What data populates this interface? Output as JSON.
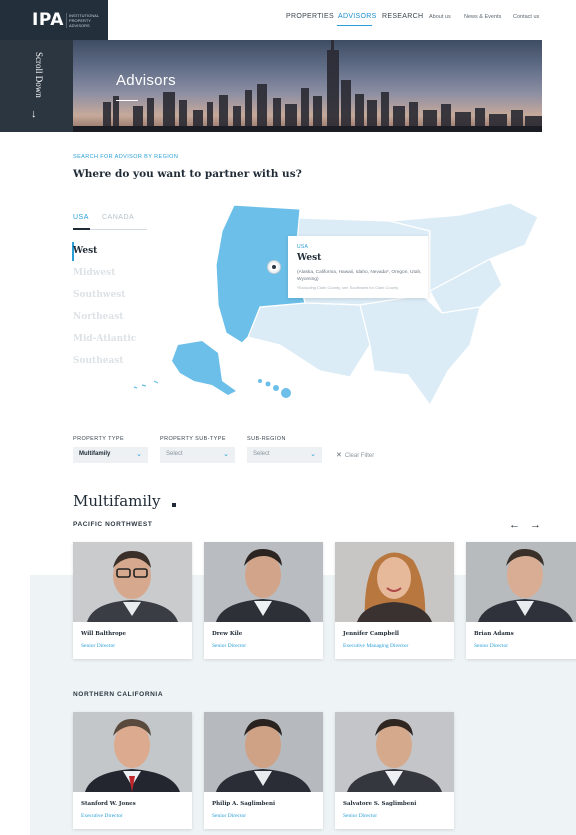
{
  "brand": {
    "logo_text": "IPA",
    "logo_subtext": "INSTITUTIONAL PROPERTY ADVISORS"
  },
  "nav": {
    "items": [
      {
        "label": "PROPERTIES"
      },
      {
        "label": "ADVISORS",
        "active": true
      },
      {
        "label": "RESEARCH"
      },
      {
        "label": "About us"
      },
      {
        "label": "News & Events"
      },
      {
        "label": "Contact us"
      }
    ]
  },
  "side": {
    "scroll_label": "Scroll Down",
    "arrow_icon": "arrow-down-icon"
  },
  "hero": {
    "title": "Advisors"
  },
  "search": {
    "eyebrow": "SEARCH FOR ADVISOR BY REGION",
    "headline": "Where do you want to partner with us?"
  },
  "country_tabs": [
    {
      "label": "USA",
      "active": true
    },
    {
      "label": "CANADA"
    }
  ],
  "regions": [
    {
      "label": "West",
      "active": true
    },
    {
      "label": "Midwest"
    },
    {
      "label": "Southwest"
    },
    {
      "label": "Northeast"
    },
    {
      "label": "Mid-Atlantic"
    },
    {
      "label": "Southeast"
    }
  ],
  "map_tooltip": {
    "country": "USA",
    "region": "West",
    "states": "(Alaska, California, Hawaii, Idaho, Nevada*, Oregon, Utah, Wyoming)",
    "note": "*Excluding Clark County, see Southwest for Clark County"
  },
  "colors": {
    "accent": "#2a9fd6",
    "map_active": "#6bbfe8",
    "map_inactive": "#dcecf6",
    "dark": "#232f3b"
  },
  "filters": {
    "property_type": {
      "label": "PROPERTY TYPE",
      "value": "Multifamily"
    },
    "property_sub_type": {
      "label": "PROPERTY SUB-TYPE",
      "value": "Select"
    },
    "sub_region": {
      "label": "SUB-REGION",
      "value": "Select"
    },
    "clear_label": "Clear Filter"
  },
  "results": {
    "title": "Multifamily",
    "prev_icon": "arrow-left-icon",
    "next_icon": "arrow-right-icon",
    "groups": [
      {
        "title": "PACIFIC NORTHWEST",
        "advisors": [
          {
            "name": "Will Balthrope",
            "role": "Senior Director"
          },
          {
            "name": "Drew Kile",
            "role": "Senior Director"
          },
          {
            "name": "Jennifer Campbell",
            "role": "Executive Managing Director"
          },
          {
            "name": "Brian Adams",
            "role": "Senior Director"
          }
        ]
      },
      {
        "title": "NORTHERN CALIFORNIA",
        "advisors": [
          {
            "name": "Stanford W. Jones",
            "role": "Executive Director"
          },
          {
            "name": "Philip A. Saglimbeni",
            "role": "Senior Director"
          },
          {
            "name": "Salvatore S. Saglimbeni",
            "role": "Senior Director"
          }
        ]
      }
    ]
  }
}
